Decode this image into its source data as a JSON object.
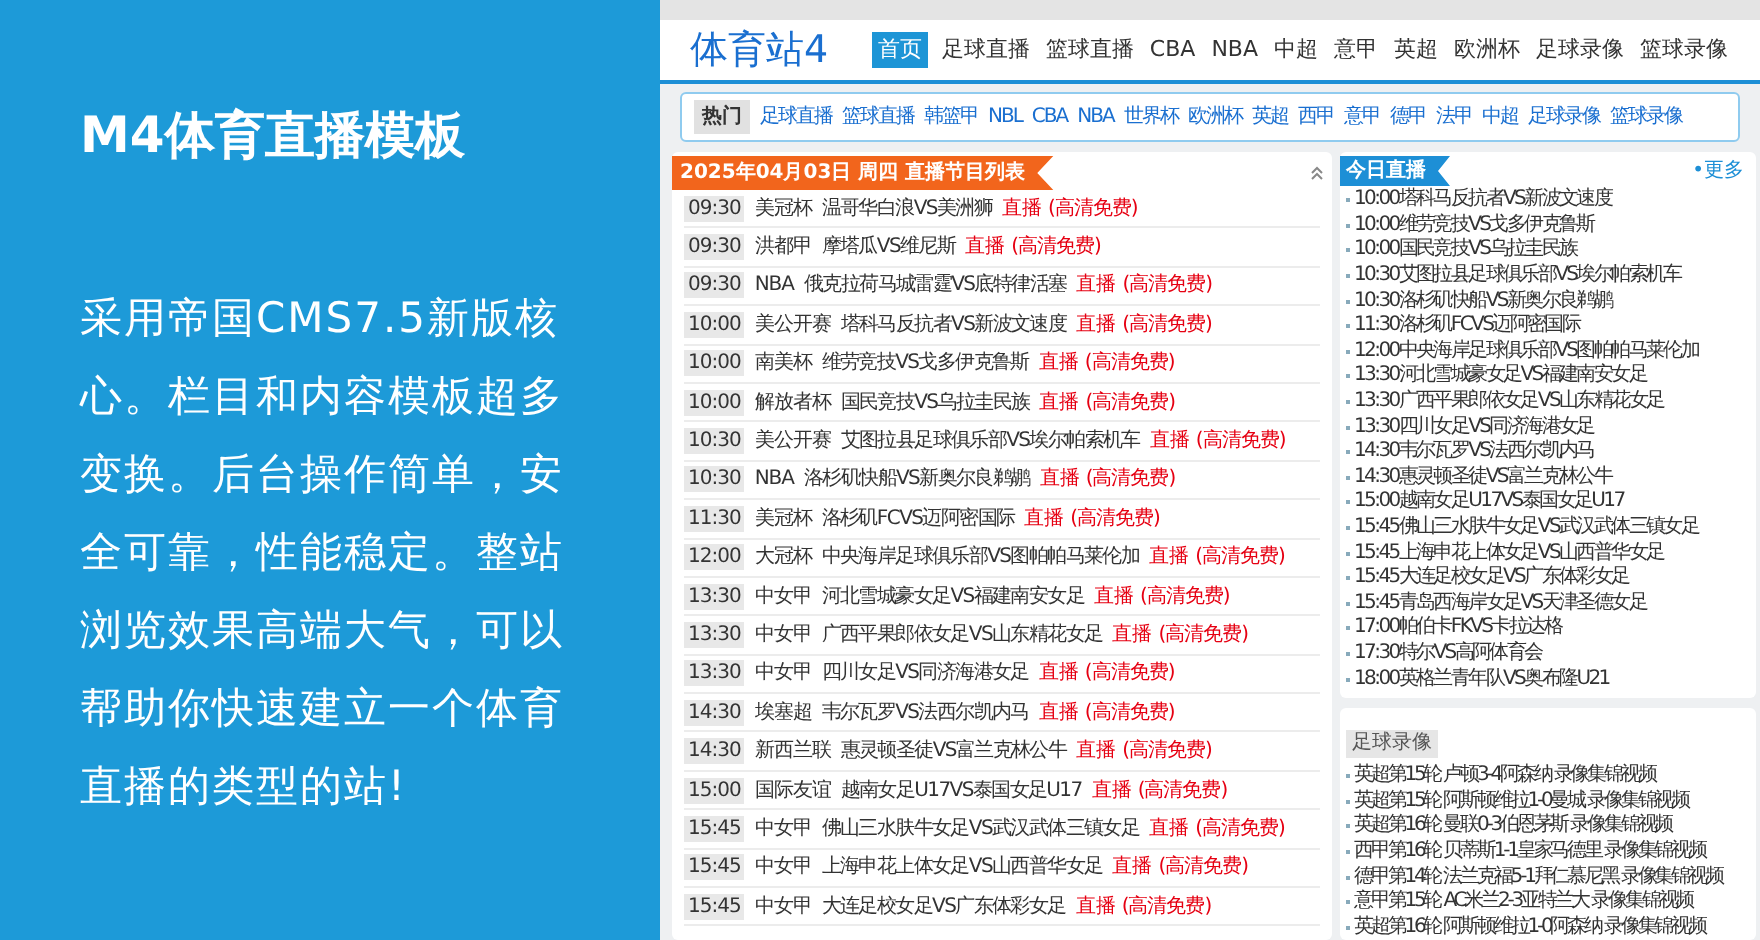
{
  "promo": {
    "title": "M4体育直播模板",
    "description": "采用帝国CMS7.5新版核心。栏目和内容模板超多变换。后台操作简单，安全可靠，性能稳定。整站浏览效果高端大气，可以帮助你快速建立一个体育直播的类型的站!"
  },
  "site": {
    "logo": "体育站4",
    "nav": [
      {
        "label": "首页",
        "selected": true
      },
      {
        "label": "足球直播",
        "selected": false
      },
      {
        "label": "篮球直播",
        "selected": false
      },
      {
        "label": "CBA",
        "selected": false
      },
      {
        "label": "NBA",
        "selected": false
      },
      {
        "label": "中超",
        "selected": false
      },
      {
        "label": "意甲",
        "selected": false
      },
      {
        "label": "英超",
        "selected": false
      },
      {
        "label": "欧洲杯",
        "selected": false
      },
      {
        "label": "足球录像",
        "selected": false
      },
      {
        "label": "篮球录像",
        "selected": false
      }
    ],
    "hot": {
      "label": "热门",
      "links": [
        "足球直播",
        "篮球直播",
        "韩篮甲",
        "NBL",
        "CBA",
        "NBA",
        "世界杯",
        "欧洲杯",
        "英超",
        "西甲",
        "意甲",
        "德甲",
        "法甲",
        "中超",
        "足球录像",
        "篮球录像"
      ]
    },
    "schedule": {
      "title": "2025年04月03日 周四 直播节目列表",
      "rows": [
        {
          "time": "09:30",
          "league": "美冠杯",
          "match": "温哥华白浪VS美洲狮",
          "live": "直播",
          "quality": "(高清免费)"
        },
        {
          "time": "09:30",
          "league": "洪都甲",
          "match": "摩塔瓜VS维尼斯",
          "live": "直播",
          "quality": "(高清免费)"
        },
        {
          "time": "09:30",
          "league": "NBA",
          "match": "俄克拉荷马城雷霆VS底特律活塞",
          "live": "直播",
          "quality": "(高清免费)"
        },
        {
          "time": "10:00",
          "league": "美公开赛",
          "match": "塔科马反抗者VS新波文速度",
          "live": "直播",
          "quality": "(高清免费)"
        },
        {
          "time": "10:00",
          "league": "南美杯",
          "match": "维劳竞技VS戈多伊克鲁斯",
          "live": "直播",
          "quality": "(高清免费)"
        },
        {
          "time": "10:00",
          "league": "解放者杯",
          "match": "国民竞技VS乌拉圭民族",
          "live": "直播",
          "quality": "(高清免费)"
        },
        {
          "time": "10:30",
          "league": "美公开赛",
          "match": "艾图拉县足球俱乐部VS埃尔帕索机车",
          "live": "直播",
          "quality": "(高清免费)"
        },
        {
          "time": "10:30",
          "league": "NBA",
          "match": "洛杉矶快船VS新奥尔良鹈鹕",
          "live": "直播",
          "quality": "(高清免费)"
        },
        {
          "time": "11:30",
          "league": "美冠杯",
          "match": "洛杉矶FCVS迈阿密国际",
          "live": "直播",
          "quality": "(高清免费)"
        },
        {
          "time": "12:00",
          "league": "大冠杯",
          "match": "中央海岸足球俱乐部VS图帕帕马莱伦加",
          "live": "直播",
          "quality": "(高清免费)"
        },
        {
          "time": "13:30",
          "league": "中女甲",
          "match": "河北雪城豪女足VS福建南安女足",
          "live": "直播",
          "quality": "(高清免费)"
        },
        {
          "time": "13:30",
          "league": "中女甲",
          "match": "广西平果郎依女足VS山东精花女足",
          "live": "直播",
          "quality": "(高清免费)"
        },
        {
          "time": "13:30",
          "league": "中女甲",
          "match": "四川女足VS同济海港女足",
          "live": "直播",
          "quality": "(高清免费)"
        },
        {
          "time": "14:30",
          "league": "埃塞超",
          "match": "韦尔瓦罗VS法西尔凯内马",
          "live": "直播",
          "quality": "(高清免费)"
        },
        {
          "time": "14:30",
          "league": "新西兰联",
          "match": "惠灵顿圣徒VS富兰克林公牛",
          "live": "直播",
          "quality": "(高清免费)"
        },
        {
          "time": "15:00",
          "league": "国际友谊",
          "match": "越南女足U17VS泰国女足U17",
          "live": "直播",
          "quality": "(高清免费)"
        },
        {
          "time": "15:45",
          "league": "中女甲",
          "match": "佛山三水肤牛女足VS武汉武体三镇女足",
          "live": "直播",
          "quality": "(高清免费)"
        },
        {
          "time": "15:45",
          "league": "中女甲",
          "match": "上海申花上体女足VS山西普华女足",
          "live": "直播",
          "quality": "(高清免费)"
        },
        {
          "time": "15:45",
          "league": "中女甲",
          "match": "大连足校女足VS广东体彩女足",
          "live": "直播",
          "quality": "(高清免费)"
        }
      ]
    },
    "today": {
      "title": "今日直播",
      "more": "•更多",
      "items": [
        "10:00塔科马反抗者VS新波文速度",
        "10:00维劳竞技VS戈多伊克鲁斯",
        "10:00国民竞技VS乌拉圭民族",
        "10:30艾图拉县足球俱乐部VS埃尔帕索机车",
        "10:30洛杉矶快船VS新奥尔良鹈鹕",
        "11:30洛杉矶FCVS迈阿密国际",
        "12:00中央海岸足球俱乐部VS图帕帕马莱伦加",
        "13:30河北雪城豪女足VS福建南安女足",
        "13:30广西平果郎依女足VS山东精花女足",
        "13:30四川女足VS同济海港女足",
        "14:30韦尔瓦罗VS法西尔凯内马",
        "14:30惠灵顿圣徒VS富兰克林公牛",
        "15:00越南女足U17VS泰国女足U17",
        "15:45佛山三水肤牛女足VS武汉武体三镇女足",
        "15:45上海申花上体女足VS山西普华女足",
        "15:45大连足校女足VS广东体彩女足",
        "15:45青岛西海岸女足VS天津圣德女足",
        "17:00帕伯卡FKVS卡拉达格",
        "17:30特尔VS高阿体育会",
        "18:00英格兰青年队VS奥布隆U21"
      ]
    },
    "videos": {
      "title": "足球录像",
      "items": [
        "英超第15轮 卢顿3-4阿森纳 录像集锦视频",
        "英超第15轮 阿斯顿维拉1-0曼城 录像集锦视频",
        "英超第16轮 曼联0-3伯恩茅斯 录像集锦视频",
        "西甲第16轮 贝蒂斯1-1皇家马德里 录像集锦视频",
        "德甲第14轮 法兰克福5-1拜仁慕尼黑 录像集锦视频",
        "意甲第15轮 AC米兰2-3亚特兰大 录像集锦视频",
        "英超第16轮 阿斯顿维拉1-0阿森纳 录像集锦视频"
      ]
    }
  }
}
